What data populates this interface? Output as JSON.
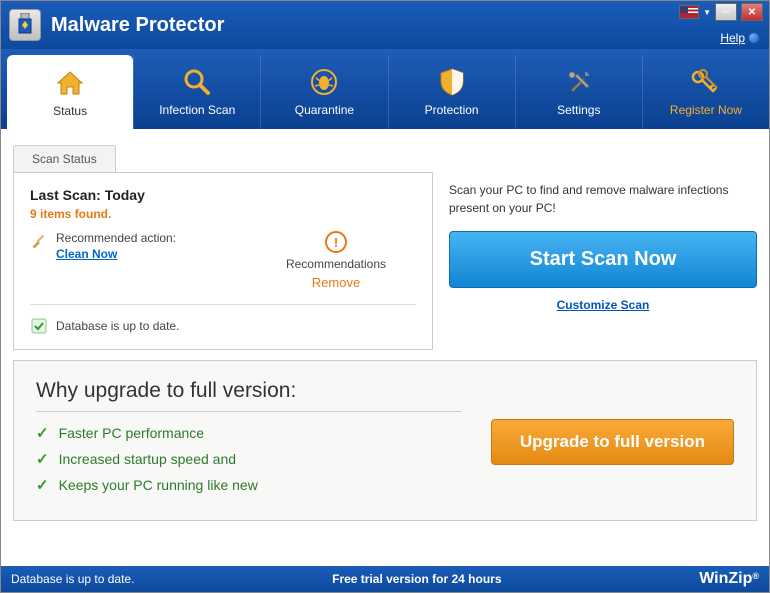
{
  "app": {
    "title": "Malware Protector",
    "help": "Help"
  },
  "tabs": [
    {
      "label": "Status"
    },
    {
      "label": "Infection Scan"
    },
    {
      "label": "Quarantine"
    },
    {
      "label": "Protection"
    },
    {
      "label": "Settings"
    },
    {
      "label": "Register Now"
    }
  ],
  "scan": {
    "tab_label": "Scan Status",
    "last_scan": "Last Scan: Today",
    "items_found": "9 items found.",
    "recommended_label": "Recommended action:",
    "clean_now": "Clean Now",
    "recommendations": "Recommendations",
    "remove": "Remove",
    "db_status": "Database is up to date."
  },
  "action": {
    "prompt": "Scan your PC to find and remove malware infections present on your PC!",
    "start_button": "Start Scan Now",
    "customize": "Customize Scan"
  },
  "upgrade": {
    "title": "Why upgrade to full version:",
    "benefits": [
      "Faster PC performance",
      "Increased startup speed and",
      "Keeps your PC running like new"
    ],
    "button": "Upgrade to full version"
  },
  "statusbar": {
    "left": "Database is up to date.",
    "center": "Free trial version for 24 hours",
    "brand": "WinZip"
  }
}
